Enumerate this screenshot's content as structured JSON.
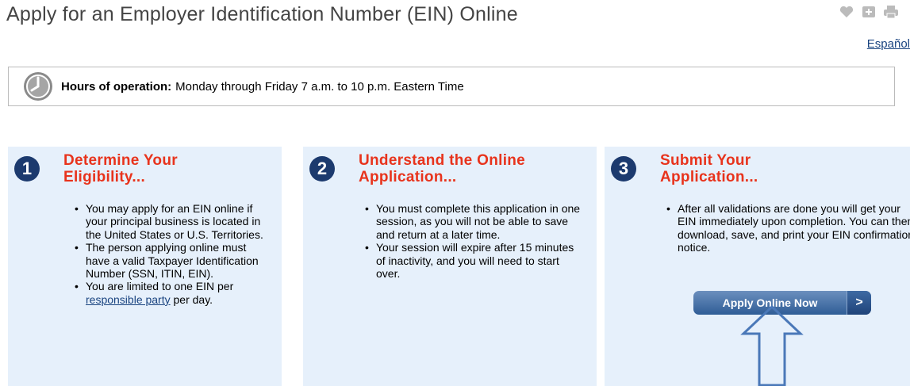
{
  "header": {
    "title": "Apply for an Employer Identification Number (EIN) Online",
    "tools": [
      "heart-icon",
      "plus-icon",
      "print-icon"
    ],
    "language_link": "Español"
  },
  "hours": {
    "label": "Hours of operation:",
    "text": "Monday through Friday 7 a.m. to 10 p.m. Eastern Time"
  },
  "steps": [
    {
      "number": "1",
      "title_line1": "Determine Your",
      "title_line2": "Eligibility...",
      "bullets": [
        "You may apply for an EIN online if your principal business is located in the United States or U.S. Territories.",
        "The person applying online must have a valid Taxpayer Identification Number (SSN, ITIN, EIN).",
        "You are limited to one EIN per",
        "responsible party",
        "per day."
      ]
    },
    {
      "number": "2",
      "title_line1": "Understand the Online",
      "title_line2": "Application...",
      "bullets": [
        "You must complete this application in one session, as you will not be able to save and return at a later time.",
        "Your session will expire after 15 minutes of inactivity, and you will need to start over."
      ]
    },
    {
      "number": "3",
      "title_line1": "Submit Your",
      "title_line2": "Application...",
      "bullets": [
        "After all validations are done you will get your EIN immediately upon completion. You can then download, save, and print your EIN confirmation notice."
      ],
      "button_label": "Apply Online Now",
      "button_arrow": ">"
    }
  ],
  "colors": {
    "step_title": "#e8331c",
    "panel_bg": "#e6f0fb",
    "step_circle": "#1c3a6e",
    "annotation_arrow": "#4a78b8"
  }
}
